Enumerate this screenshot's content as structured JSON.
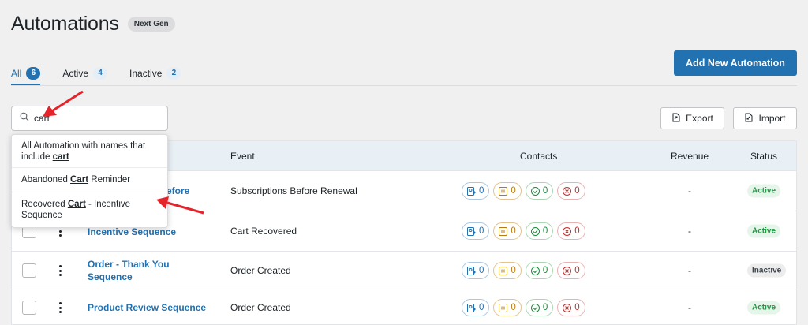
{
  "header": {
    "title": "Automations",
    "badge": "Next Gen"
  },
  "tabs": [
    {
      "label": "All",
      "count": "6",
      "active": true
    },
    {
      "label": "Active",
      "count": "4",
      "active": false
    },
    {
      "label": "Inactive",
      "count": "2",
      "active": false
    }
  ],
  "actions": {
    "add_label": "Add New Automation",
    "export_label": "Export",
    "import_label": "Import"
  },
  "search": {
    "value": "cart",
    "placeholder": ""
  },
  "dropdown": {
    "all_prefix": "All Automation with names that include ",
    "all_term": "cart",
    "items": [
      {
        "before": "Abandoned ",
        "match": "Cart",
        "after": " Reminder"
      },
      {
        "before": "Recovered ",
        "match": "Cart",
        "after": " - Incentive Sequence"
      }
    ]
  },
  "table": {
    "headers": {
      "event": "Event",
      "contacts": "Contacts",
      "revenue": "Revenue",
      "status": "Status"
    },
    "rows": [
      {
        "name": "Subscriptions Before Renewal",
        "name_visible": "efore",
        "event": "Subscriptions Before Renewal",
        "contacts": [
          "0",
          "0",
          "0",
          "0"
        ],
        "revenue": "-",
        "status": "Active"
      },
      {
        "name": "Incentive Sequence",
        "event": "Cart Recovered",
        "contacts": [
          "0",
          "0",
          "0",
          "0"
        ],
        "revenue": "-",
        "status": "Active"
      },
      {
        "name": "Order - Thank You Sequence",
        "event": "Order Created",
        "contacts": [
          "0",
          "0",
          "0",
          "0"
        ],
        "revenue": "-",
        "status": "Inactive"
      },
      {
        "name": "Product Review Sequence",
        "event": "Order Created",
        "contacts": [
          "0",
          "0",
          "0",
          "0"
        ],
        "revenue": "-",
        "status": "Active"
      }
    ]
  },
  "colors": {
    "primary": "#2271b1",
    "annotation_arrow": "#e5232b",
    "active_status": "#1e9a45"
  }
}
